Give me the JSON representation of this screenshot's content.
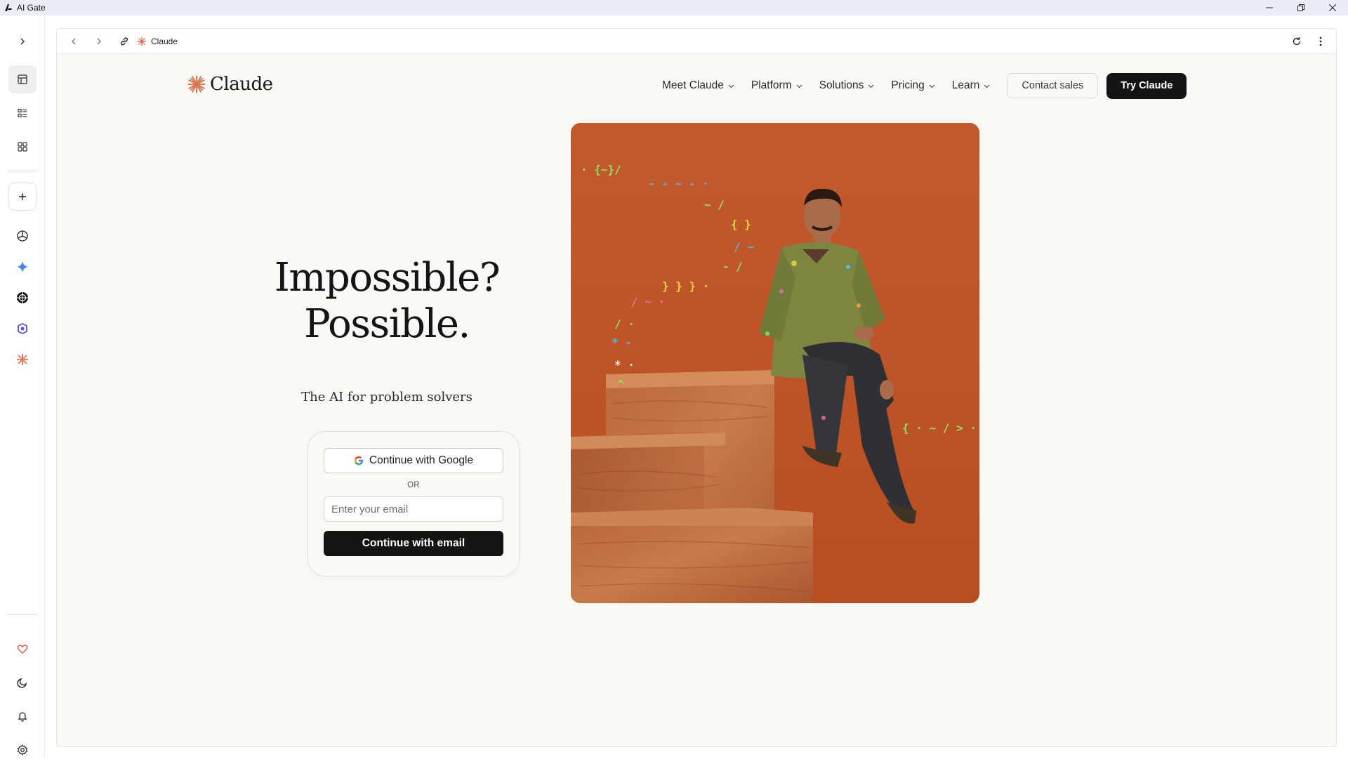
{
  "window": {
    "title": "AI Gate",
    "controls": [
      "minimize",
      "maximize",
      "close"
    ]
  },
  "rail": {
    "top_items": [
      {
        "name": "expand-icon"
      },
      {
        "name": "layout-panel-icon",
        "active": true
      },
      {
        "name": "list-icon"
      },
      {
        "name": "grid-icon"
      }
    ],
    "add_button": "plus-icon",
    "services": [
      {
        "name": "chatgpt-icon"
      },
      {
        "name": "gemini-icon"
      },
      {
        "name": "perplexity-icon"
      },
      {
        "name": "copilot-icon"
      },
      {
        "name": "claude-icon"
      }
    ],
    "bottom_items": [
      {
        "name": "heart-icon",
        "color": "#e05252"
      },
      {
        "name": "moon-icon"
      },
      {
        "name": "bell-icon"
      },
      {
        "name": "gear-icon"
      }
    ]
  },
  "browser": {
    "tab_title": "Claude",
    "actions": [
      "back-icon",
      "forward-icon",
      "link-icon",
      "reload-icon",
      "more-icon"
    ]
  },
  "page": {
    "brand": "Claude",
    "nav": [
      {
        "label": "Meet Claude"
      },
      {
        "label": "Platform"
      },
      {
        "label": "Solutions"
      },
      {
        "label": "Pricing"
      },
      {
        "label": "Learn"
      }
    ],
    "contact_label": "Contact sales",
    "try_label": "Try Claude",
    "hero": {
      "line1": "Impossible?",
      "line2": "Possible.",
      "subtitle": "The AI for problem solvers"
    },
    "signin": {
      "google_label": "Continue with Google",
      "or_label": "OR",
      "email_placeholder": "Enter your email",
      "email_button": "Continue with email"
    }
  },
  "colors": {
    "accent": "#d97757",
    "page_bg": "#faf9f5",
    "primary_button": "#141413",
    "hero_bg": "#c2562a"
  }
}
